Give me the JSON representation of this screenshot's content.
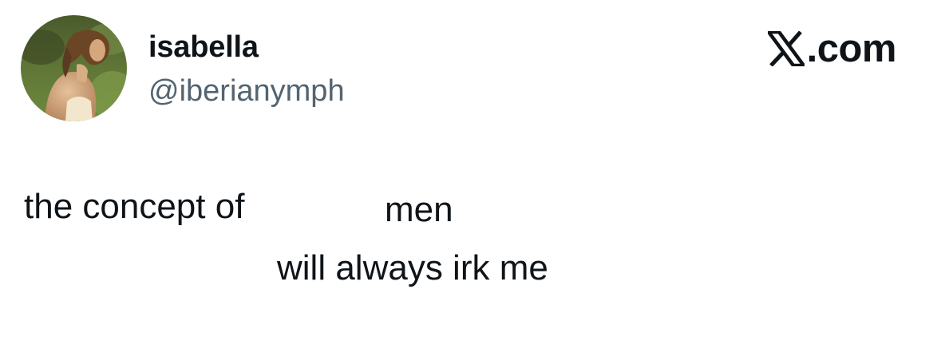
{
  "user": {
    "display_name": "isabella",
    "handle": "@iberianymph",
    "avatar_icon": "profile-photo"
  },
  "brand": {
    "icon": "x-logo-icon",
    "domain_suffix": ".com"
  },
  "tweet": {
    "text_fragments": [
      "the concept of",
      "men",
      "will always irk me"
    ]
  }
}
